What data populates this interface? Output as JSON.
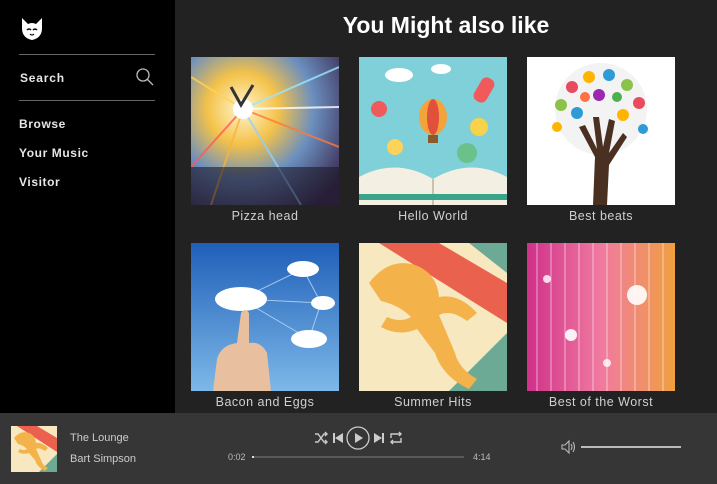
{
  "sidebar": {
    "search_label": "Search",
    "items": [
      {
        "label": "Browse"
      },
      {
        "label": "Your Music"
      },
      {
        "label": "Visitor"
      }
    ]
  },
  "main": {
    "title": "You Might also like",
    "albums": [
      {
        "caption": "Pizza head"
      },
      {
        "caption": "Hello World"
      },
      {
        "caption": "Best beats"
      },
      {
        "caption": "Bacon and Eggs"
      },
      {
        "caption": "Summer Hits"
      },
      {
        "caption": "Best of the Worst"
      }
    ]
  },
  "player": {
    "track_title": "The Lounge",
    "artist": "Bart Simpson",
    "elapsed": "0:02",
    "duration": "4:14",
    "progress_fraction": 0.01,
    "volume_fraction": 1.0
  },
  "colors": {
    "sidebar_bg": "#000000",
    "main_bg": "#222222",
    "player_bg": "#363636"
  }
}
